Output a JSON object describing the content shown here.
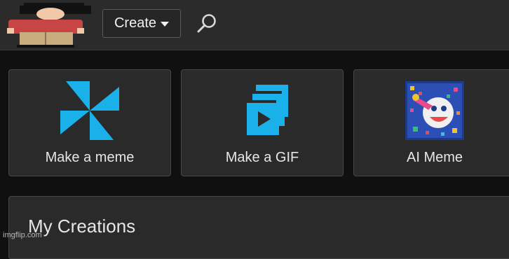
{
  "header": {
    "create_label": "Create",
    "logo_icon": "cartoon-character-logo-icon",
    "search_icon": "search-icon"
  },
  "cards": [
    {
      "label": "Make a meme",
      "icon": "pinwheel-icon"
    },
    {
      "label": "Make a GIF",
      "icon": "stacked-play-icon"
    },
    {
      "label": "AI Meme",
      "icon": "ai-meme-art-icon"
    }
  ],
  "creations": {
    "title": "My Creations"
  },
  "watermark": "imgflip.com",
  "colors": {
    "accent": "#1ab0ea",
    "background": "#101010",
    "topbar": "#2b2b2b",
    "card": "#2a2a2a"
  }
}
